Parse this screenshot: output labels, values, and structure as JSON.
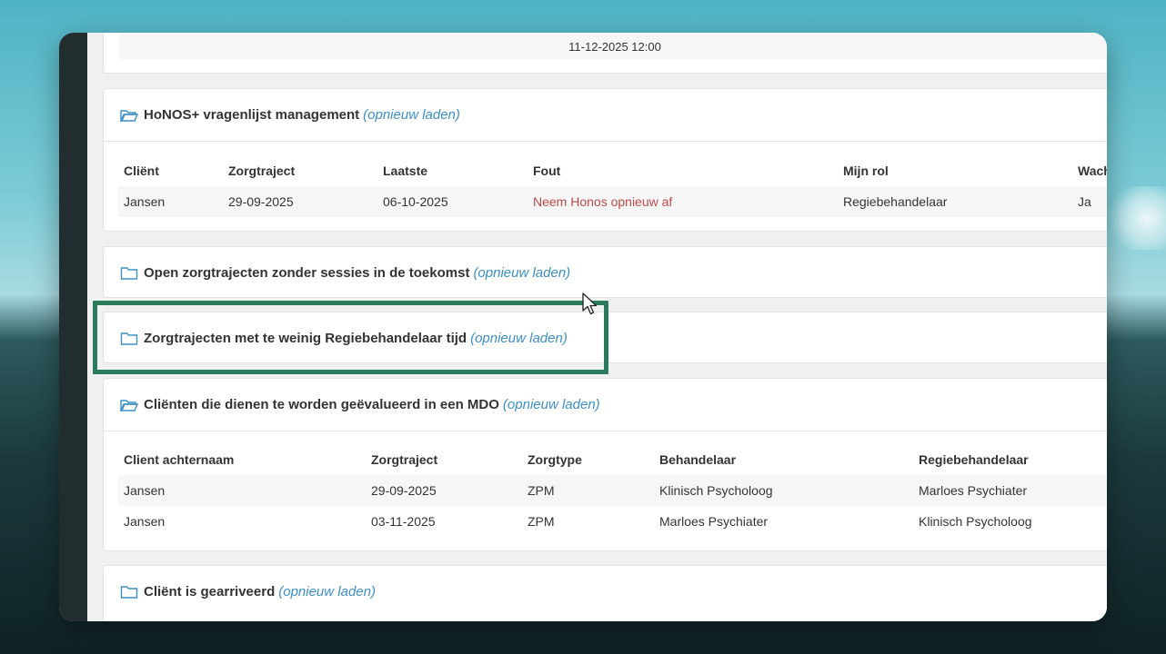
{
  "top_panel": {
    "datetime": "11-12-2025 12:00"
  },
  "honos": {
    "title": "HoNOS+ vragenlijst management",
    "reload": "(opnieuw laden)",
    "columns": [
      "Cliënt",
      "Zorgtraject",
      "Laatste",
      "Fout",
      "Mijn rol",
      "Wach"
    ],
    "rows": [
      [
        "Jansen",
        "29-09-2025",
        "06-10-2025",
        "Neem Honos opnieuw af",
        "Regiebehandelaar",
        "Ja"
      ]
    ]
  },
  "open_trajects": {
    "title": "Open zorgtrajecten zonder sessies in de toekomst",
    "reload": "(opnieuw laden)"
  },
  "regie_tijd": {
    "title": "Zorgtrajecten met te weinig Regiebehandelaar tijd",
    "reload": "(opnieuw laden)"
  },
  "mdo": {
    "title": "Cliënten die dienen te worden geëvalueerd in een MDO",
    "reload": "(opnieuw laden)",
    "columns": [
      "Client achternaam",
      "Zorgtraject",
      "Zorgtype",
      "Behandelaar",
      "Regiebehandelaar"
    ],
    "rows": [
      [
        "Jansen",
        "29-09-2025",
        "ZPM",
        "Klinisch Psycholoog",
        "Marloes Psychiater"
      ],
      [
        "Jansen",
        "03-11-2025",
        "ZPM",
        "Marloes Psychiater",
        "Klinisch Psycholoog"
      ]
    ]
  },
  "gearriveerd": {
    "title": "Cliënt is gearriveerd",
    "reload": "(opnieuw laden)"
  },
  "colors": {
    "accent_link": "#3d8fc4",
    "error": "#b94a48",
    "highlight": "#2a7a5c"
  },
  "icons": {
    "folder_open": "folder-open-icon",
    "folder_closed": "folder-icon",
    "cursor": "mouse-cursor-icon"
  }
}
